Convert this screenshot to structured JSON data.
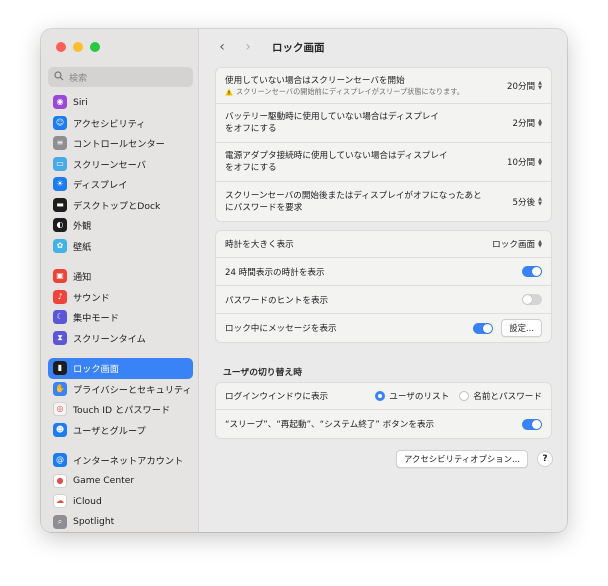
{
  "window": {
    "title": "ロック画面"
  },
  "search": {
    "placeholder": "検索"
  },
  "sidebar": {
    "groups": [
      [
        {
          "label": "Siri",
          "icon": "siri-icon",
          "color": "#9b4ad6"
        },
        {
          "label": "アクセシビリティ",
          "icon": "accessibility-icon",
          "color": "#1e7cf2"
        },
        {
          "label": "コントロールセンター",
          "icon": "control-center-icon",
          "color": "#8e8e93"
        },
        {
          "label": "スクリーンセーバ",
          "icon": "screensaver-icon",
          "color": "#48a9e6"
        },
        {
          "label": "ディスプレイ",
          "icon": "display-icon",
          "color": "#1e7cf2"
        },
        {
          "label": "デスクトップとDock",
          "icon": "dock-icon",
          "color": "#1d1d1f"
        },
        {
          "label": "外観",
          "icon": "appearance-icon",
          "color": "#1d1d1f"
        },
        {
          "label": "壁紙",
          "icon": "wallpaper-icon",
          "color": "#3fb2e8"
        }
      ],
      [
        {
          "label": "通知",
          "icon": "notifications-icon",
          "color": "#f0443a"
        },
        {
          "label": "サウンド",
          "icon": "sound-icon",
          "color": "#f0443a"
        },
        {
          "label": "集中モード",
          "icon": "focus-icon",
          "color": "#5b56d6"
        },
        {
          "label": "スクリーンタイム",
          "icon": "screen-time-icon",
          "color": "#5b56d6"
        }
      ],
      [
        {
          "label": "ロック画面",
          "icon": "lock-screen-icon",
          "color": "#1d1d1f",
          "active": true
        },
        {
          "label": "プライバシーとセキュリティ",
          "icon": "privacy-hand-icon",
          "color": "#3a83f7"
        },
        {
          "label": "Touch ID とパスワード",
          "icon": "touch-id-icon",
          "color": "#f3f3f3"
        },
        {
          "label": "ユーザとグループ",
          "icon": "users-icon",
          "color": "#1e7cf2"
        }
      ],
      [
        {
          "label": "インターネットアカウント",
          "icon": "internet-accounts-icon",
          "color": "#1e7cf2"
        },
        {
          "label": "Game Center",
          "icon": "game-center-icon",
          "color": "#ffffff"
        },
        {
          "label": "iCloud",
          "icon": "icloud-icon",
          "color": "#ffffff"
        },
        {
          "label": "Spotlight",
          "icon": "spotlight-icon",
          "color": "#8e8e93"
        }
      ]
    ]
  },
  "group1": {
    "rows": [
      {
        "label": "使用していない場合はスクリーンセーバを開始",
        "note": "スクリーンセーバの開始前にディスプレイがスリープ状態になります。",
        "value": "20分間"
      },
      {
        "label": "バッテリー駆動時に使用していない場合はディスプレイ",
        "label2": "をオフにする",
        "value": "2分間"
      },
      {
        "label": "電源アダプタ接続時に使用していない場合はディスプレイ",
        "label2": "をオフにする",
        "value": "10分間"
      },
      {
        "label": "スクリーンセーバの開始後またはディスプレイがオフになったあと",
        "label2": "にパスワードを要求",
        "value": "5分後"
      }
    ]
  },
  "group2": {
    "clock_size": {
      "label": "時計を大きく表示",
      "value": "ロック画面"
    },
    "clock_24h": {
      "label": "24 時間表示の時計を表示",
      "on": true
    },
    "password_hint": {
      "label": "パスワードのヒントを表示",
      "on": false
    },
    "message": {
      "label": "ロック中にメッセージを表示",
      "on": true,
      "button": "設定..."
    }
  },
  "section": {
    "title": "ユーザの切り替え時"
  },
  "group3": {
    "login_window": {
      "label": "ログインウインドウに表示",
      "option1": "ユーザのリスト",
      "option2": "名前とパスワード",
      "selected": 1
    },
    "buttons": {
      "label": "“スリープ”、“再起動”、“システム終了” ボタンを表示",
      "on": true
    }
  },
  "footer": {
    "accessibility_button": "アクセシビリティオプション...",
    "help": "?"
  },
  "colors": {
    "accent": "#3a83f7",
    "sidebar_bg": "#e6e4e3",
    "content_bg": "#ebeaea"
  }
}
